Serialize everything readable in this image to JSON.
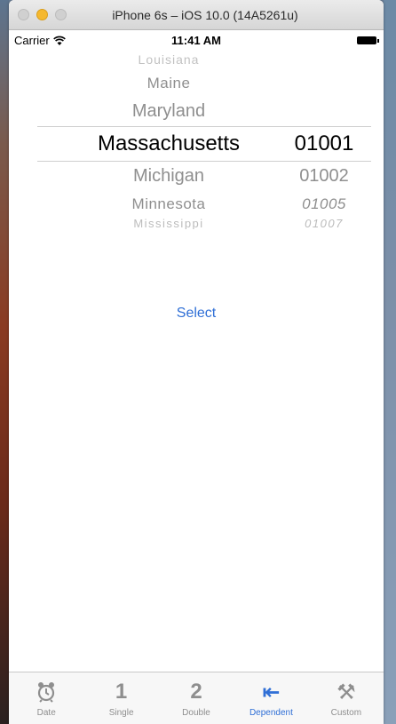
{
  "window": {
    "title": "iPhone 6s – iOS 10.0 (14A5261u)"
  },
  "status_bar": {
    "carrier": "Carrier",
    "time": "11:41 AM"
  },
  "picker": {
    "states": [
      "Louisiana",
      "Maine",
      "Maryland",
      "Massachusetts",
      "Michigan",
      "Minnesota",
      "Mississippi"
    ],
    "zips": [
      "01001",
      "01002",
      "01005",
      "01007"
    ],
    "selected_state": "Massachusetts",
    "selected_zip": "01001"
  },
  "actions": {
    "select_label": "Select"
  },
  "tab_bar": {
    "items": [
      {
        "label": "Date",
        "icon": "alarm-clock-icon"
      },
      {
        "label": "Single",
        "icon": "digit-1-icon",
        "glyph": "1"
      },
      {
        "label": "Double",
        "icon": "digit-2-icon",
        "glyph": "2"
      },
      {
        "label": "Dependent",
        "icon": "arrow-left-bar-icon",
        "glyph": "⇤",
        "active": true
      },
      {
        "label": "Custom",
        "icon": "tools-icon",
        "glyph": "⚒"
      }
    ]
  },
  "colors": {
    "accent": "#2f6fd6",
    "tab_inactive": "#8e8e8e"
  }
}
